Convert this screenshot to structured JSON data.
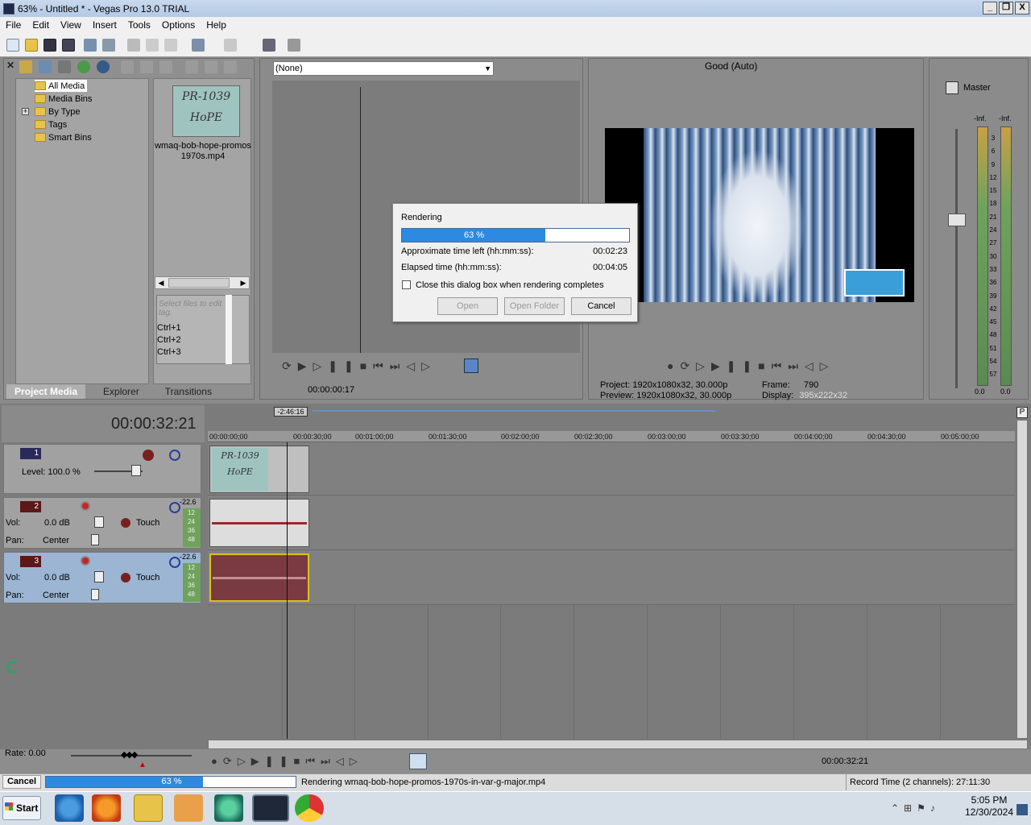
{
  "window": {
    "title": "63% - Untitled * - Vegas Pro 13.0 TRIAL",
    "min": "_",
    "restore": "❐",
    "close": "X"
  },
  "menu": [
    "File",
    "Edit",
    "View",
    "Insert",
    "Tools",
    "Options",
    "Help"
  ],
  "explorer": {
    "tree": [
      {
        "label": "All Media"
      },
      {
        "label": "Media Bins"
      },
      {
        "label": "By Type"
      },
      {
        "label": "Tags"
      },
      {
        "label": "Smart Bins"
      }
    ],
    "expander": "+",
    "media_file": "wmaq-bob-hope-promos 1970s.mp4",
    "thumb_text1": "PR-1039",
    "thumb_text2": "HoPE",
    "tag_placeholder": "Select files to edit tag.",
    "tag_shortcuts": [
      "Ctrl+1",
      "Ctrl+2",
      "Ctrl+3"
    ],
    "tabs": [
      "Project Media",
      "Explorer",
      "Transitions"
    ]
  },
  "trimmer": {
    "select": "(None)",
    "timecode": "00:00:00:17"
  },
  "preview": {
    "quality": "Good (Auto)",
    "project": "Project:  1920x1080x32, 30.000p",
    "preview": "Preview:  1920x1080x32, 30.000p",
    "frame_label": "Frame:",
    "frame_value": "790",
    "display_label": "Display:",
    "display_value": "395x222x32"
  },
  "master": {
    "label": "Master",
    "inf_left": "-Inf.",
    "inf_right": "-Inf.",
    "scale": [
      "3",
      "6",
      "9",
      "12",
      "15",
      "18",
      "21",
      "24",
      "27",
      "30",
      "33",
      "36",
      "39",
      "42",
      "45",
      "48",
      "51",
      "54",
      "57"
    ],
    "bottom_left": "0.0",
    "bottom_right": "0.0"
  },
  "dialog": {
    "title": "Rendering",
    "progress": "63 %",
    "progress_fraction": 0.63,
    "time_left_label": "Approximate time left (hh:mm:ss):",
    "time_left": "00:02:23",
    "elapsed_label": "Elapsed time (hh:mm:ss):",
    "elapsed": "00:04:05",
    "checkbox_label": "Close this dialog box when rendering completes",
    "open": "Open",
    "open_folder": "Open Folder",
    "cancel": "Cancel"
  },
  "timeline": {
    "timecode": "00:00:32:21",
    "marker": "-2:46:16",
    "ticks": [
      "00:00:00;00",
      "00:00:30;00",
      "00:01:00;00",
      "00:01:30;00",
      "00:02:00;00",
      "00:02:30;00",
      "00:03:00;00",
      "00:03:30;00",
      "00:04:00;00",
      "00:04:30;00",
      "00:05:00;00"
    ],
    "track1": {
      "num": "1",
      "level": "Level: 100.0 %"
    },
    "track2": {
      "num": "2",
      "vol_label": "Vol:",
      "vol": "0.0 dB",
      "pan_label": "Pan:",
      "pan": "Center",
      "mode": "Touch",
      "peak": "-22.6",
      "meter": [
        "12",
        "24",
        "36",
        "48"
      ]
    },
    "track3": {
      "num": "3",
      "vol_label": "Vol:",
      "vol": "0.0 dB",
      "pan_label": "Pan:",
      "pan": "Center",
      "mode": "Touch",
      "peak": "-22.6",
      "meter": [
        "12",
        "24",
        "36",
        "48"
      ]
    },
    "rate": "Rate: 0.00",
    "bottom_timecode": "00:00:32:21"
  },
  "status": {
    "cancel": "Cancel",
    "progress": "63 %",
    "progress_fraction": 0.63,
    "message": "Rendering wmaq-bob-hope-promos-1970s-in-var-g-major.mp4",
    "record_time": "Record Time (2 channels): 27:11:30"
  },
  "taskbar": {
    "start": "Start",
    "time": "5:05 PM",
    "date": "12/30/2024"
  }
}
